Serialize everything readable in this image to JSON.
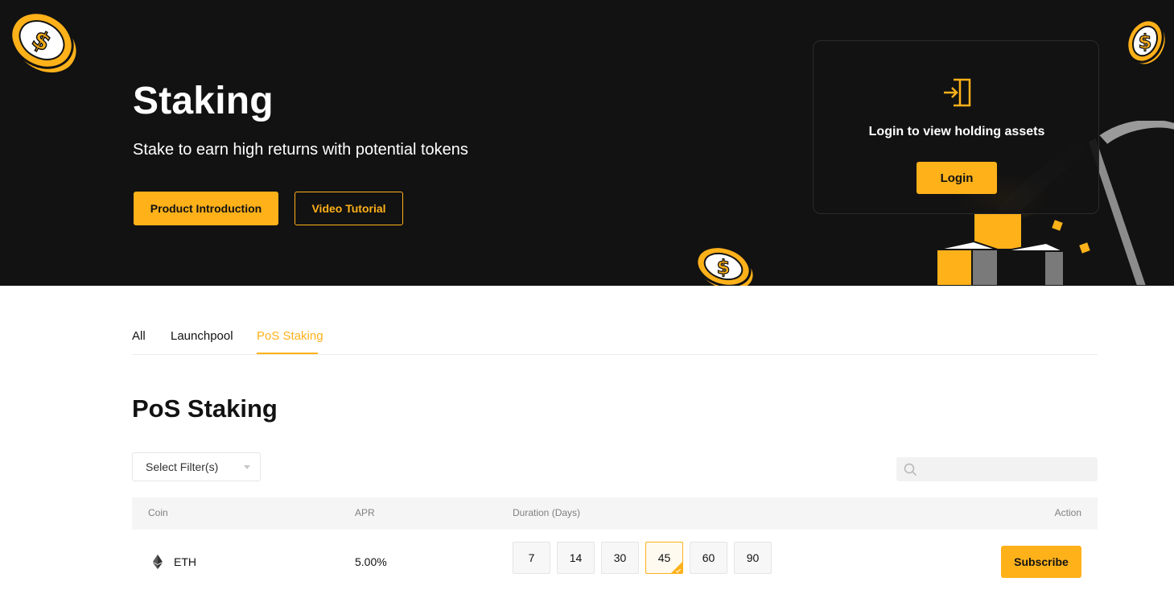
{
  "hero": {
    "title": "Staking",
    "subtitle": "Stake to earn high returns with potential tokens",
    "primary_button": "Product Introduction",
    "secondary_button": "Video Tutorial"
  },
  "login_card": {
    "message": "Login to view holding assets",
    "button": "Login",
    "icon": "login-door-icon"
  },
  "tabs": [
    {
      "label": "All",
      "active": false
    },
    {
      "label": "Launchpool",
      "active": false
    },
    {
      "label": "PoS Staking",
      "active": true
    }
  ],
  "section": {
    "title": "PoS Staking"
  },
  "filter": {
    "placeholder": "Select Filter(s)"
  },
  "search": {
    "icon": "search-icon",
    "value": ""
  },
  "table": {
    "headers": {
      "coin": "Coin",
      "apr": "APR",
      "duration": "Duration (Days)",
      "action": "Action"
    },
    "rows": [
      {
        "coin": "ETH",
        "coin_icon": "ethereum-icon",
        "apr": "5.00%",
        "durations": [
          "7",
          "14",
          "30",
          "45",
          "60",
          "90"
        ],
        "selected_duration": "45",
        "action": "Subscribe"
      }
    ]
  },
  "colors": {
    "accent": "#ffb11a",
    "hero_bg": "#121212",
    "text": "#121212"
  }
}
